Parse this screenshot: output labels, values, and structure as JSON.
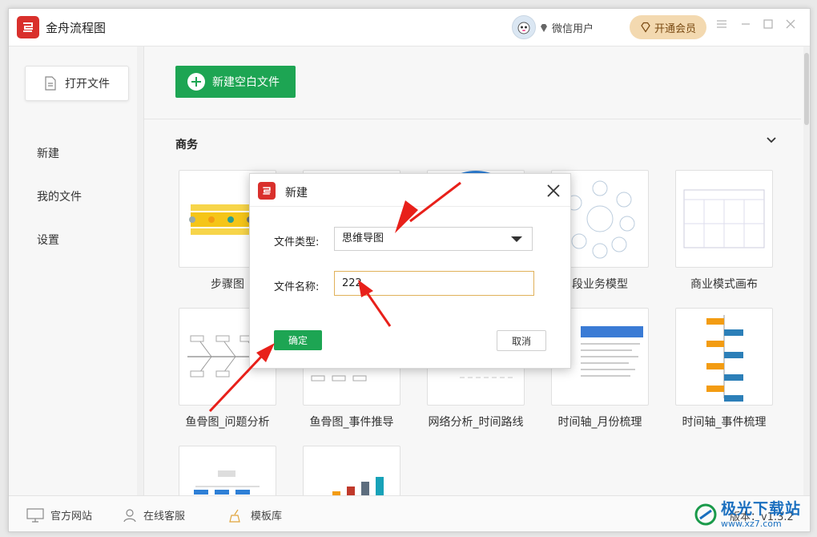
{
  "app": {
    "title": "金舟流程图"
  },
  "titlebar": {
    "user_name": "微信用户",
    "vip_label": "开通会员"
  },
  "sidebar": {
    "open_file": "打开文件",
    "items": [
      {
        "label": "新建"
      },
      {
        "label": "我的文件"
      },
      {
        "label": "设置"
      }
    ]
  },
  "main": {
    "new_blank_label": "新建空白文件",
    "section_title": "商务",
    "templates": [
      {
        "label": "步骤图"
      },
      {
        "label": ""
      },
      {
        "label": ""
      },
      {
        "label": "段业务模型"
      },
      {
        "label": "商业模式画布"
      },
      {
        "label": "鱼骨图_问题分析"
      },
      {
        "label": "鱼骨图_事件推导"
      },
      {
        "label": "网络分析_时间路线"
      },
      {
        "label": "时间轴_月份梳理"
      },
      {
        "label": "时间轴_事件梳理"
      },
      {
        "label": ""
      },
      {
        "label": ""
      }
    ]
  },
  "footer": {
    "website": "官方网站",
    "support": "在线客服",
    "templates": "模板库",
    "version": "版本：v1.3.2"
  },
  "dialog": {
    "title": "新建",
    "type_label": "文件类型:",
    "type_value": "思维导图",
    "name_label": "文件名称:",
    "name_value": "222",
    "ok_label": "确定",
    "cancel_label": "取消"
  },
  "watermark": {
    "main": "极光下载站",
    "sub": "www.xz7.com"
  },
  "colors": {
    "accent_green": "#1da553",
    "brand_red": "#d9302c",
    "vip_gold": "#f3d9b0",
    "arrow_red": "#e8201a"
  }
}
